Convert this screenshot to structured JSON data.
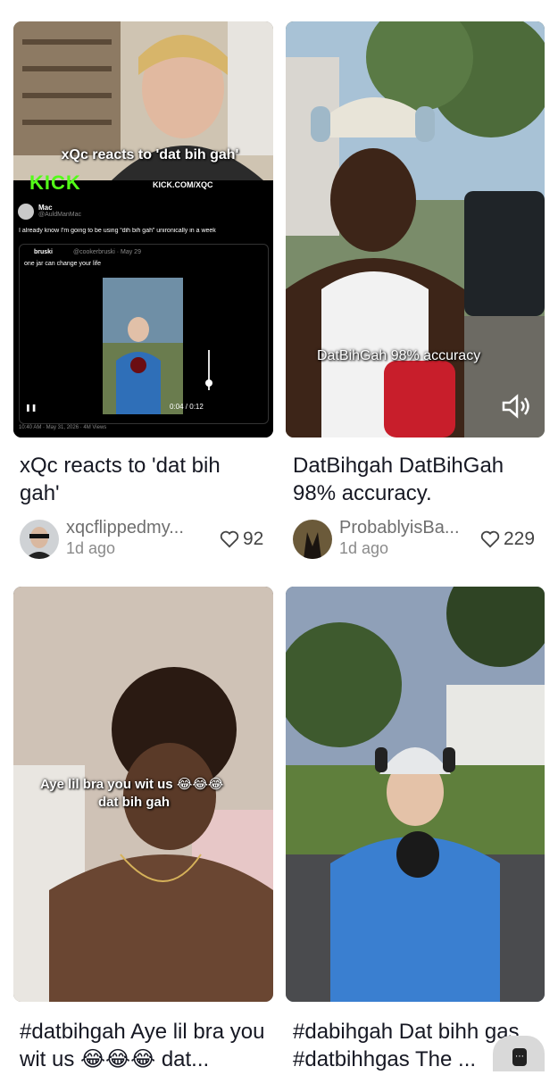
{
  "cards": [
    {
      "thumb_overlay": {
        "title": "xQc reacts to 'dat bih gah'",
        "kick_logo": "KICK",
        "kick_url": "KICK.COM/XQC",
        "tweet_name": "Mac",
        "tweet_handle": "@AuldManMac",
        "tweet_text": "I already know I'm going to be using “dih bih gah” unironically in a week",
        "quote_name": "bruski",
        "quote_handle": "@cookerbruski · May 29",
        "quote_text": "one jar can change your life",
        "video_time": "0:04 / 0:12",
        "tweet_footer": "10:40 AM · May 31, 2026 · 4M Views"
      },
      "caption": "xQc reacts to 'dat bih gah'",
      "author": "xqcflippedmy...",
      "age": "1d ago",
      "likes": "92"
    },
    {
      "thumb_overlay": {
        "text": "DatBihGah 98% accuracy"
      },
      "caption": "DatBihgah DatBihGah 98% accuracy.",
      "author": "ProbablyisBa...",
      "age": "1d ago",
      "likes": "229"
    },
    {
      "thumb_overlay": {
        "line1": "Aye lil bra you wit us 😂😂😂",
        "line2": "dat bih gah"
      },
      "caption": "#datbihgah Aye lil bra you wit us 😂😂😂 dat...",
      "author": "",
      "age": "",
      "likes": ""
    },
    {
      "thumb_overlay": {},
      "caption": "#dabihgah Dat bihh gas #datbihhgas The ...",
      "author": "",
      "age": "",
      "likes": ""
    }
  ],
  "icons": {
    "heart": "heart-icon",
    "speaker": "speaker-icon",
    "more": "more-options-icon"
  }
}
